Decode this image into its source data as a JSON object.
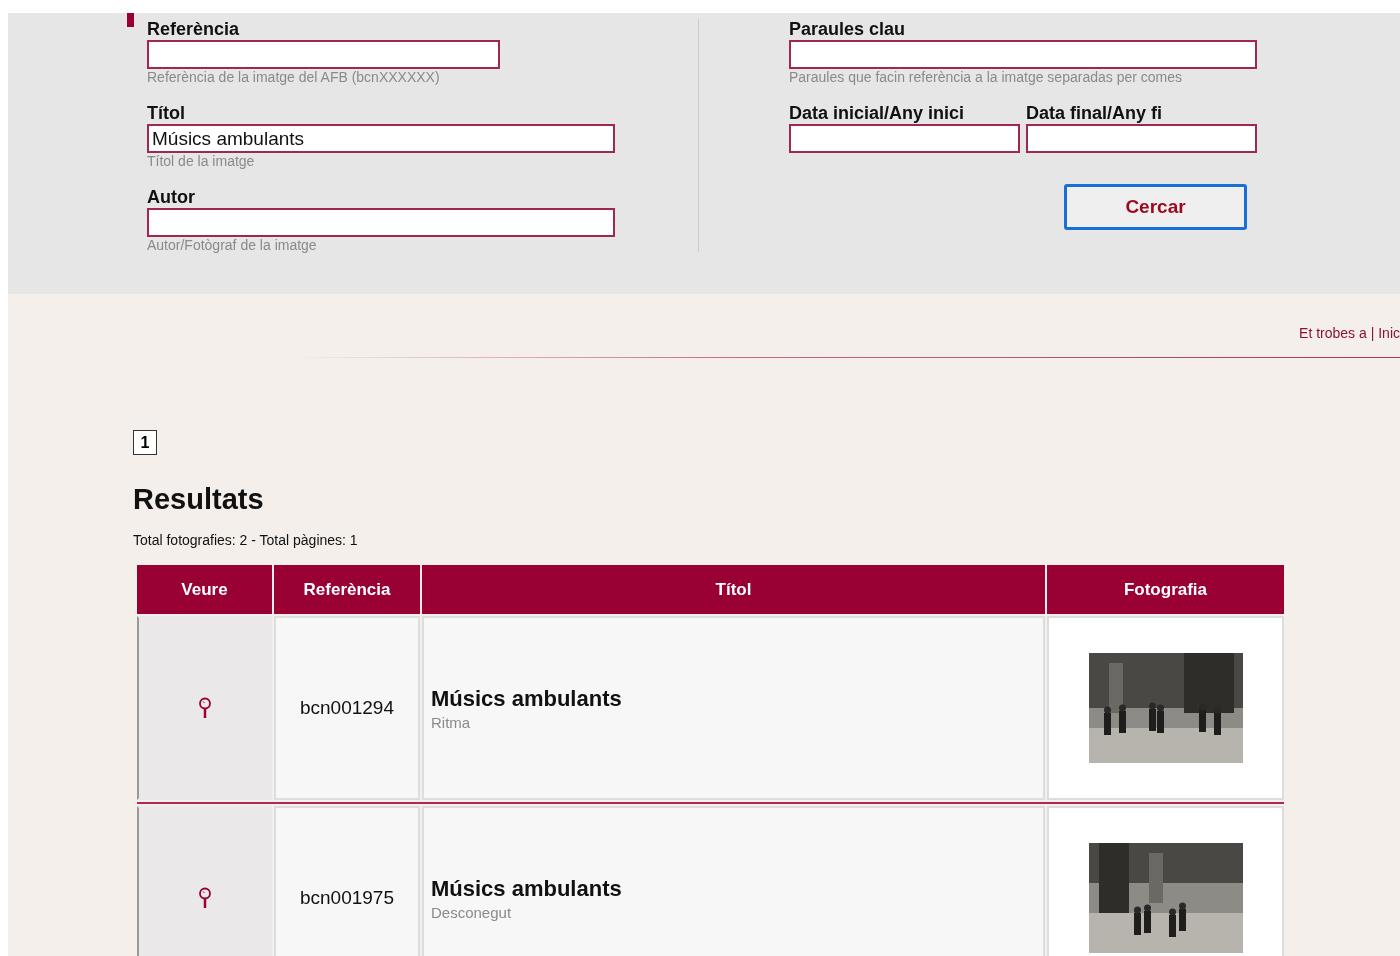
{
  "search_form": {
    "left_fields": [
      {
        "label": "Referència",
        "hint": "Referència de la imatge del AFB (bcnXXXXXX)"
      },
      {
        "label": "Títol",
        "value": "Músics ambulants",
        "hint": "Títol de la imatge"
      },
      {
        "label": "Autor",
        "hint": "Autor/Fotògraf de la imatge"
      }
    ],
    "keywords": {
      "label": "Paraules clau",
      "hint": "Paraules que facin referència a la imatge separadas per comes"
    },
    "date_fields": [
      {
        "label": "Data inicial/Any inici"
      },
      {
        "label": "Data final/Any fi"
      }
    ],
    "button": "Cercar"
  },
  "breadcrumb": "Et trobes a | Inic",
  "pagination": [
    {
      "label": "1",
      "selected": true
    }
  ],
  "results": {
    "title": "Resultats",
    "summary": "Total fotografies: 2 - Total pàgines: 1",
    "columns": [
      "Veure",
      "Referència",
      "Títol",
      "Fotografia"
    ],
    "rows": [
      {
        "reference": "bcn001294",
        "title": "Músics ambulants",
        "author": "Ritma"
      },
      {
        "reference": "bcn001975",
        "title": "Músics ambulants",
        "author": "Desconegut"
      }
    ]
  }
}
